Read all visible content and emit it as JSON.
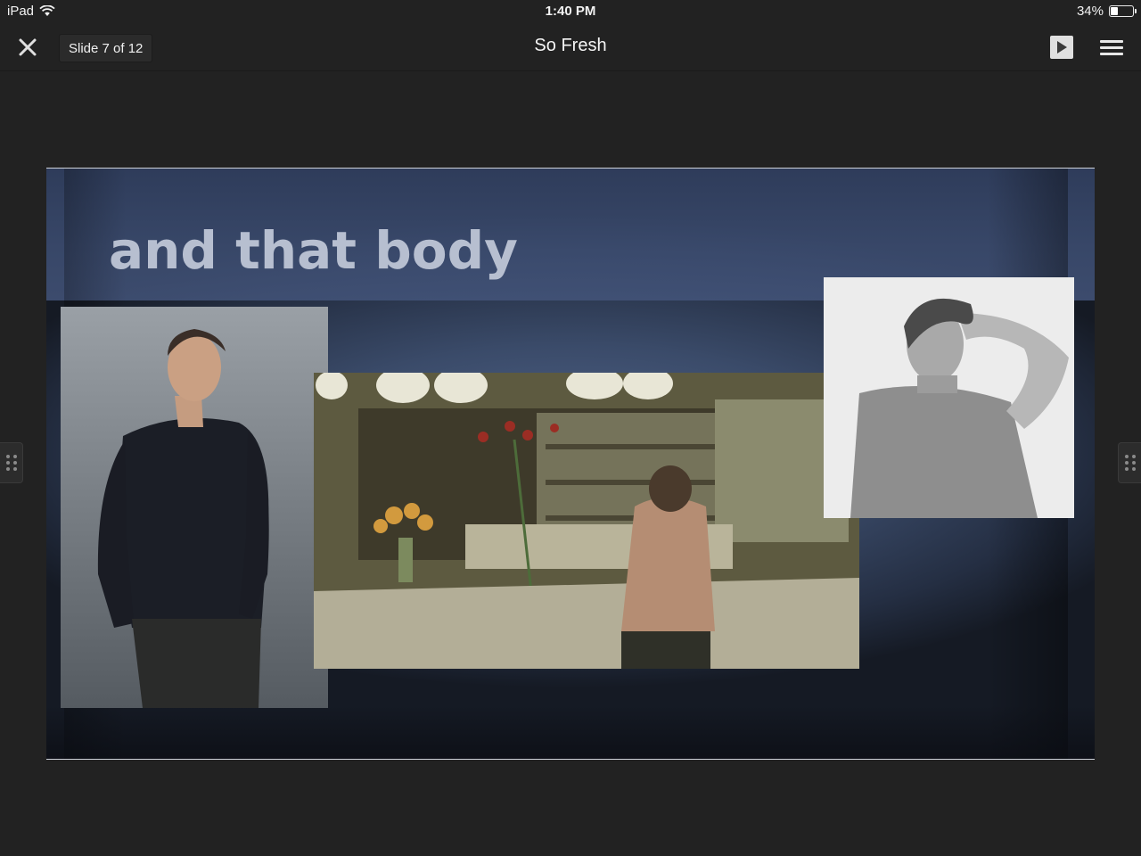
{
  "status_bar": {
    "device": "iPad",
    "time": "1:40 PM",
    "battery": "34%",
    "battery_level_percent": 34
  },
  "toolbar": {
    "close_icon": "close-icon",
    "slide_counter": "Slide 7 of 12",
    "title": "So Fresh",
    "play_icon": "play-icon",
    "menu_icon": "hamburger-menu-icon"
  },
  "slide": {
    "title": "and that body",
    "title_color": "#b7bfd0",
    "background_color": "#3e4f74",
    "photos": [
      {
        "name": "photo-man-black-sweater"
      },
      {
        "name": "photo-kitchen-scene"
      },
      {
        "name": "photo-man-grey-tshirt"
      }
    ]
  },
  "colors": {
    "app_background": "#222222",
    "toolbar_text": "#f5f5f5"
  }
}
